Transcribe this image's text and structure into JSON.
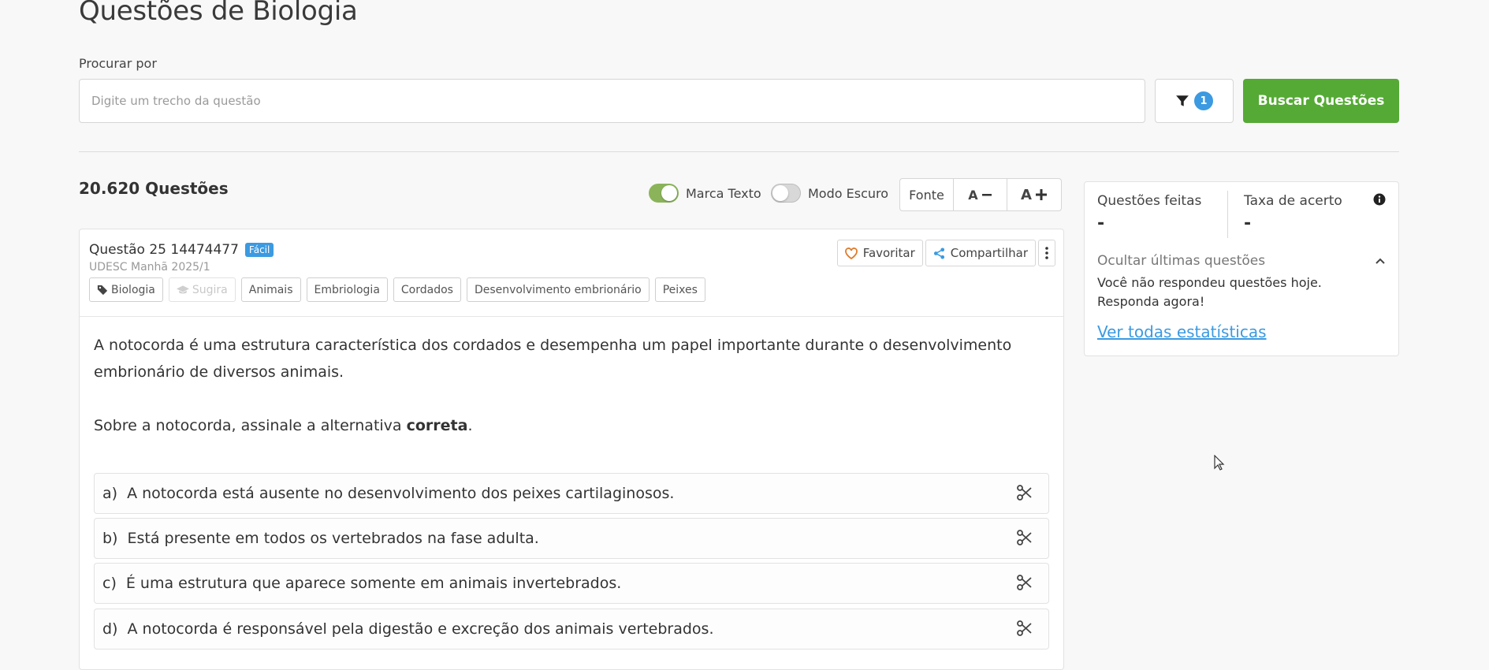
{
  "page": {
    "title": "Questões de Biologia"
  },
  "search": {
    "label": "Procurar por",
    "placeholder": "Digite um trecho da questão",
    "filter_count": "1",
    "button_label": "Buscar Questões"
  },
  "toolbar": {
    "question_count": "20.620 Questões",
    "highlight_label": "Marca Texto",
    "highlight_on": true,
    "dark_mode_label": "Modo Escuro",
    "dark_mode_on": false,
    "font_label": "Fonte",
    "font_decrease_label": "A",
    "font_increase_label": "A"
  },
  "question": {
    "title": "Questão 25 14474477",
    "difficulty": "Fácil",
    "exam": "UDESC Manhã 2025/1",
    "tags": [
      "Biologia",
      "Sugira",
      "Animais",
      "Embriologia",
      "Cordados",
      "Desenvolvimento embrionário",
      "Peixes"
    ],
    "favorite_label": "Favoritar",
    "share_label": "Compartilhar",
    "statement_1": "A notocorda é uma estrutura característica dos cordados e desempenha um papel importante durante o desenvolvimento embrionário de diversos animais.",
    "statement_2_prefix": "Sobre a notocorda, assinale a alternativa ",
    "statement_2_bold": "correta",
    "statement_2_suffix": ".",
    "alternatives": [
      {
        "letter": "a)",
        "text": "A notocorda está ausente no desenvolvimento dos peixes cartilaginosos."
      },
      {
        "letter": "b)",
        "text": "Está presente em todos os vertebrados na fase adulta."
      },
      {
        "letter": "c)",
        "text": "É uma estrutura que aparece somente em animais invertebrados."
      },
      {
        "letter": "d)",
        "text": "A notocorda é responsável pela digestão e excreção dos animais vertebrados."
      }
    ]
  },
  "stats": {
    "done_label": "Questões feitas",
    "done_value": "-",
    "accuracy_label": "Taxa de acerto",
    "accuracy_value": "-",
    "hide_last_label": "Ocultar últimas questões",
    "no_answers_msg": "Você não respondeu questões hoje. Responda agora!",
    "all_stats_link": "Ver todas estatísticas"
  },
  "colors": {
    "primary_green": "#55aa35",
    "accent_blue": "#3b9ae1",
    "toggle_on": "#8bb45a"
  }
}
